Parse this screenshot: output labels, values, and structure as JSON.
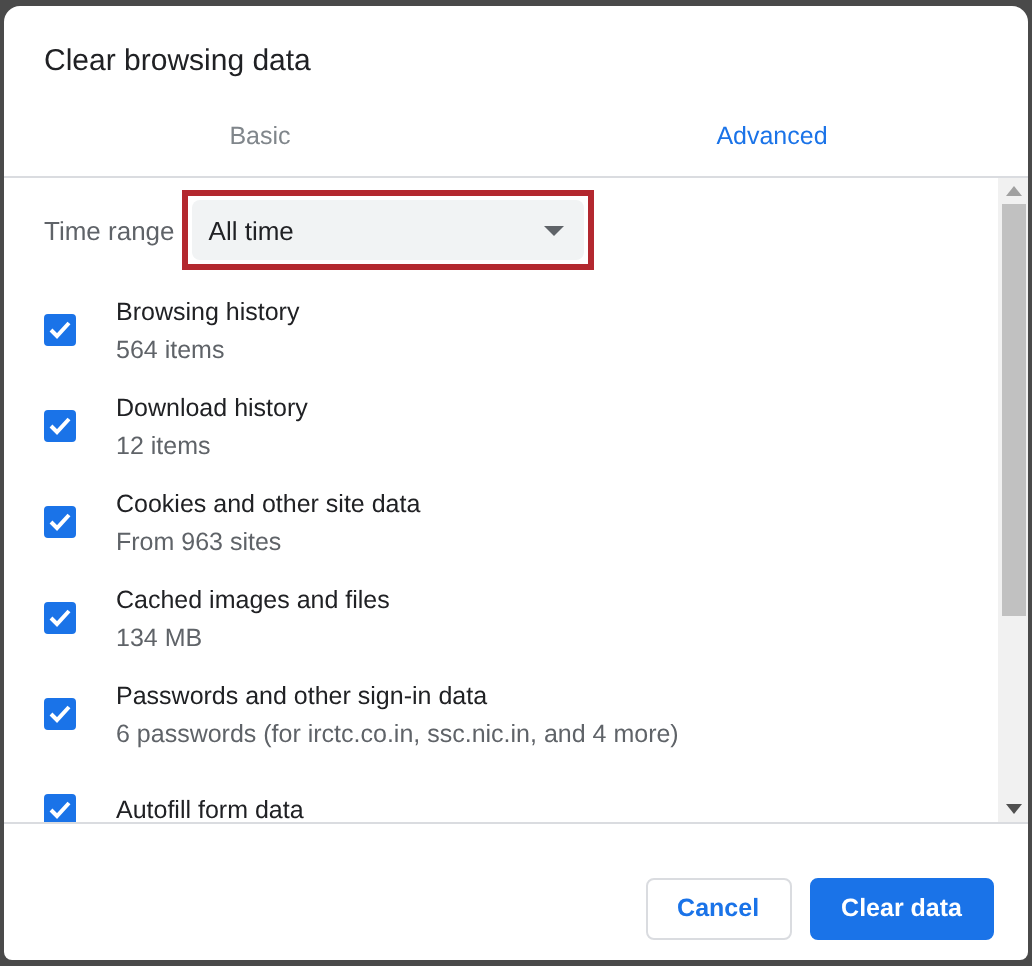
{
  "dialog": {
    "title": "Clear browsing data"
  },
  "tabs": [
    {
      "label": "Basic",
      "selected": false
    },
    {
      "label": "Advanced",
      "selected": true
    }
  ],
  "time_range": {
    "label": "Time range",
    "value": "All time",
    "highlighted": true
  },
  "options": [
    {
      "label": "Browsing history",
      "detail": "564 items",
      "checked": true
    },
    {
      "label": "Download history",
      "detail": "12 items",
      "checked": true
    },
    {
      "label": "Cookies and other site data",
      "detail": "From 963 sites",
      "checked": true
    },
    {
      "label": "Cached images and files",
      "detail": "134 MB",
      "checked": true
    },
    {
      "label": "Passwords and other sign-in data",
      "detail": "6 passwords (for irctc.co.in, ssc.nic.in, and 4 more)",
      "checked": true
    },
    {
      "label": "Autofill form data",
      "checked": true
    }
  ],
  "buttons": [
    {
      "label": "Cancel",
      "kind": "secondary"
    },
    {
      "label": "Clear data",
      "kind": "primary"
    }
  ]
}
